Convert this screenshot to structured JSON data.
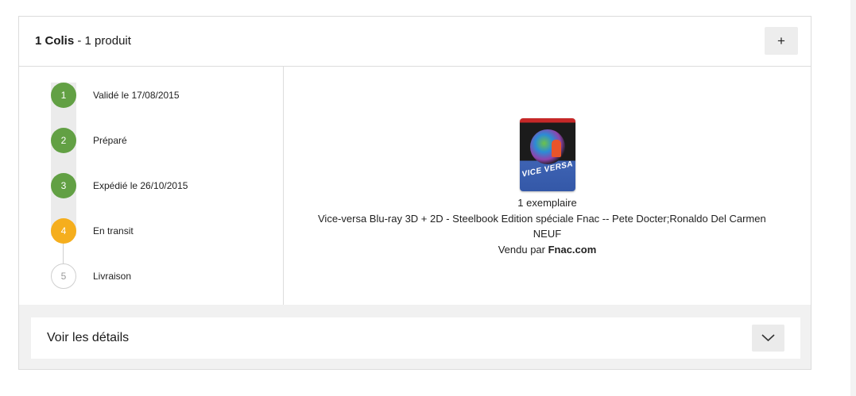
{
  "header": {
    "colis_label": "1 Colis",
    "separator": " - ",
    "product_count": "1 produit",
    "expand_label": "+"
  },
  "steps": [
    {
      "number": "1",
      "label": "Validé le 17/08/2015",
      "status": "done"
    },
    {
      "number": "2",
      "label": "Préparé",
      "status": "done"
    },
    {
      "number": "3",
      "label": "Expédié le 26/10/2015",
      "status": "done"
    },
    {
      "number": "4",
      "label": "En transit",
      "status": "current"
    },
    {
      "number": "5",
      "label": "Livraison",
      "status": "todo"
    }
  ],
  "product": {
    "cover_title": "VICE VERSA",
    "quantity": "1 exemplaire",
    "title": "Vice-versa Blu-ray 3D + 2D - Steelbook Edition spéciale Fnac -- Pete Docter;Ronaldo Del Carmen",
    "condition": "NEUF",
    "seller_prefix": "Vendu par ",
    "seller": "Fnac.com"
  },
  "footer": {
    "details_label": "Voir les détails",
    "toggle_icon": "chevron-down-icon"
  },
  "colors": {
    "step_done": "#62a044",
    "step_current": "#f5ae1d",
    "step_todo_border": "#cfcfcf",
    "panel_border": "#dcdcdc",
    "footer_bg": "#f1f1f1",
    "button_bg": "#ededed"
  }
}
